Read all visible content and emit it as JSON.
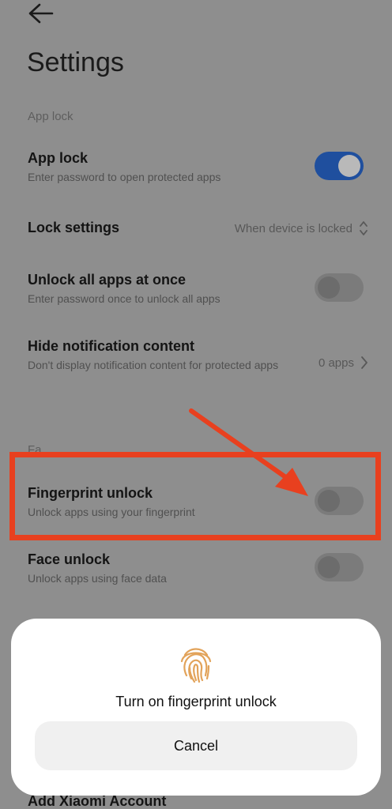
{
  "header": {
    "title": "Settings",
    "back_icon": "arrow-left-icon"
  },
  "sections": {
    "app_lock": "App lock",
    "partial": "Fa..."
  },
  "rows": {
    "app_lock": {
      "title": "App lock",
      "subtitle": "Enter password to open protected apps",
      "enabled": true
    },
    "lock_settings": {
      "title": "Lock settings",
      "value": "When device is locked"
    },
    "unlock_all": {
      "title": "Unlock all apps at once",
      "subtitle": "Enter password once to unlock all apps",
      "enabled": false
    },
    "hide_notif": {
      "title": "Hide notification content",
      "subtitle": "Don't display notification content for protected apps",
      "value": "0 apps"
    },
    "fingerprint": {
      "title": "Fingerprint unlock",
      "subtitle": "Unlock apps using your fingerprint",
      "enabled": false
    },
    "face": {
      "title": "Face unlock",
      "subtitle": "Unlock apps using face data",
      "enabled": false
    },
    "xiaomi": {
      "title": "Add Xiaomi Account"
    }
  },
  "dialog": {
    "title": "Turn on fingerprint unlock",
    "cancel_label": "Cancel",
    "icon": "fingerprint-icon"
  },
  "colors": {
    "annotation": "#e8401f",
    "toggle_on": "#1f4f9e",
    "fingerprint": "#e2a35a"
  }
}
